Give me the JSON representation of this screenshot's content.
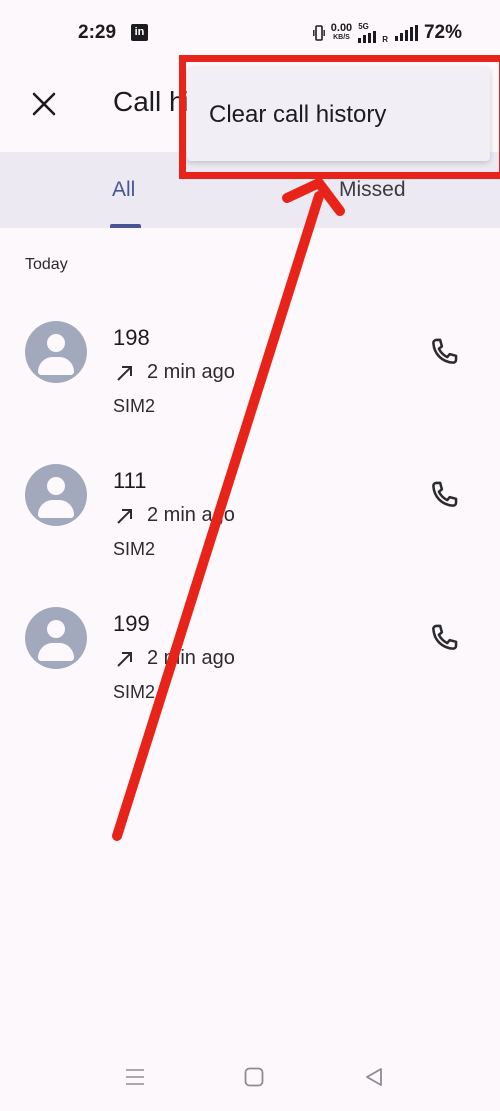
{
  "status_bar": {
    "time": "2:29",
    "app_badge": "in",
    "net_speed_value": "0.00",
    "net_speed_unit": "KB/S",
    "network_type": "5G",
    "roaming_label": "R",
    "battery": "72%"
  },
  "app_bar": {
    "title": "Call history",
    "close_icon": "close-icon"
  },
  "tabs": [
    {
      "label": "All",
      "selected": true
    },
    {
      "label": "Missed",
      "selected": false
    }
  ],
  "section": {
    "label": "Today"
  },
  "calls": [
    {
      "number": "198",
      "direction_icon": "outgoing-arrow-icon",
      "time_ago": "2 min ago",
      "sim": "SIM2"
    },
    {
      "number": "111",
      "direction_icon": "outgoing-arrow-icon",
      "time_ago": "2 min ago",
      "sim": "SIM2"
    },
    {
      "number": "199",
      "direction_icon": "outgoing-arrow-icon",
      "time_ago": "2 min ago",
      "sim": "SIM2"
    }
  ],
  "overflow_menu": {
    "items": [
      "Clear call history"
    ]
  },
  "colors": {
    "accent": "#4a5596",
    "avatar": "#a3a9bc",
    "annotation": "#e8241a",
    "tab_bar_bg": "#ece9f3",
    "background": "#fdf8fb"
  },
  "nav_bar": {
    "icons": [
      "menu-icon",
      "home-icon",
      "back-icon"
    ]
  }
}
